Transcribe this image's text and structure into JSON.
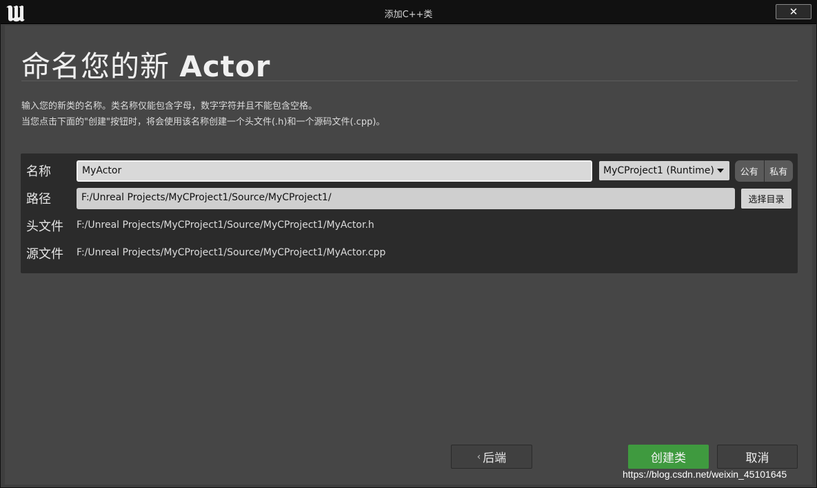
{
  "window": {
    "title": "添加C++类",
    "close_label": "✕"
  },
  "header": {
    "title_prefix": "命名您的新 ",
    "title_class": "Actor",
    "description_line1": "输入您的新类的名称。类名称仅能包含字母，数字字符并且不能包含空格。",
    "description_line2": "当您点击下面的\"创建\"按钮时，将会使用该名称创建一个头文件(.h)和一个源码文件(.cpp)。"
  },
  "form": {
    "name_label": "名称",
    "name_value": "MyActor",
    "module_value": "MyCProject1 (Runtime)",
    "visibility_public": "公有",
    "visibility_private": "私有",
    "path_label": "路径",
    "path_value": "F:/Unreal Projects/MyCProject1/Source/MyCProject1/",
    "choose_dir_label": "选择目录",
    "header_label": "头文件",
    "header_value": "F:/Unreal Projects/MyCProject1/Source/MyCProject1/MyActor.h",
    "source_label": "源文件",
    "source_value": "F:/Unreal Projects/MyCProject1/Source/MyCProject1/MyActor.cpp"
  },
  "footer": {
    "back_label": "后端",
    "create_label": "创建类",
    "cancel_label": "取消",
    "create_color": "#3f9a3f"
  },
  "watermark": "https://blog.csdn.net/weixin_45101645",
  "icons": {
    "logo": "unreal-logo-icon",
    "close": "close-icon",
    "back": "chevron-left-icon",
    "dropdown": "caret-down-icon"
  }
}
